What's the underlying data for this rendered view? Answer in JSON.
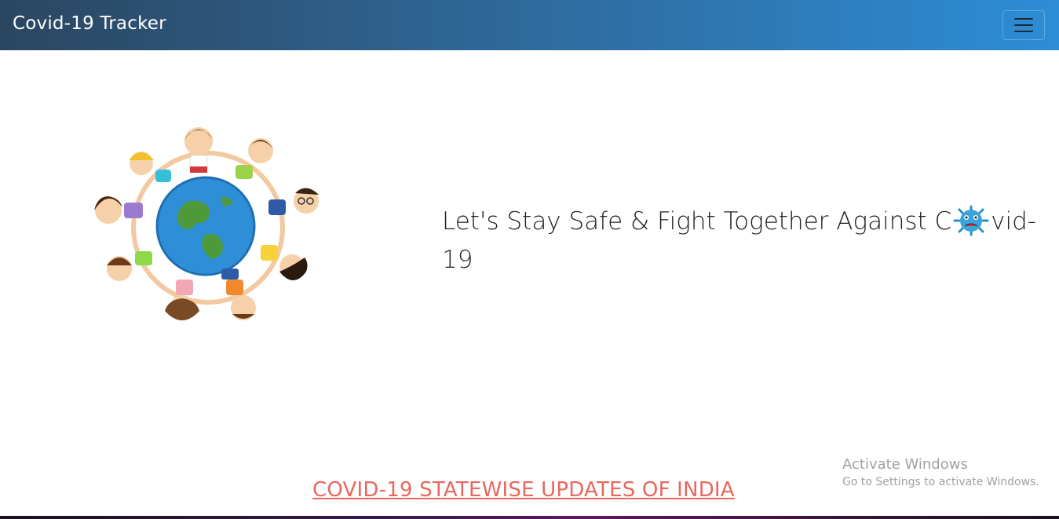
{
  "navbar": {
    "brand": "Covid-19 Tracker",
    "menu_icon": "hamburger-menu-icon",
    "gradient_start": "#2b4660",
    "gradient_end": "#2d8dd6"
  },
  "hero": {
    "image_icon": "children-around-globe-illustration",
    "text_before": "Let's Stay Safe & Fight Together Against C",
    "virus_icon": "virus-icon",
    "text_after": "vid-19"
  },
  "footer_link": {
    "label": "COVID-19 STATEWISE UPDATES OF INDIA",
    "color": "#e8675e"
  },
  "watermark": {
    "title": "Activate Windows",
    "subtitle": "Go to Settings to activate Windows."
  }
}
